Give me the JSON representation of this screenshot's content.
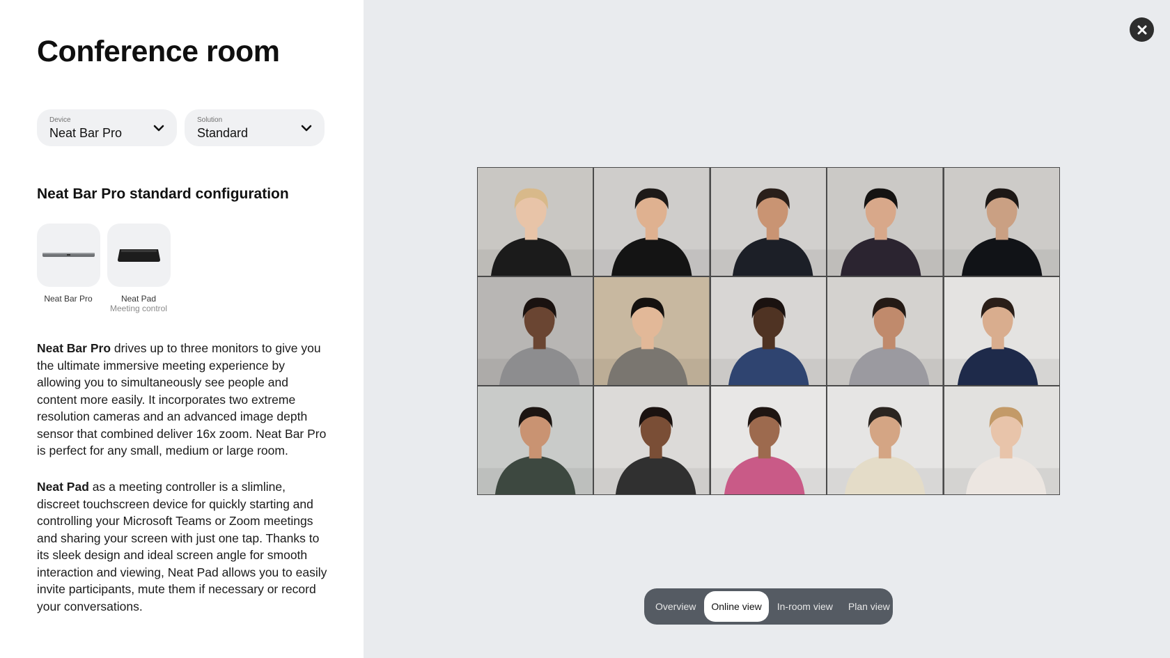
{
  "page": {
    "title": "Conference room"
  },
  "selectors": {
    "device": {
      "label": "Device",
      "value": "Neat Bar Pro"
    },
    "solution": {
      "label": "Solution",
      "value": "Standard"
    }
  },
  "configuration": {
    "heading": "Neat Bar Pro standard configuration",
    "items": [
      {
        "name": "Neat Bar Pro",
        "subtitle": ""
      },
      {
        "name": "Neat Pad",
        "subtitle": "Meeting control"
      }
    ]
  },
  "description": {
    "p1_bold": "Neat Bar Pro",
    "p1_text": " drives up to three monitors to give you the ultimate immersive meeting experience by allowing you to simultaneously see people and content more easily. It incorporates two extreme resolution cameras and an advanced image depth sensor that combined deliver 16x zoom. Neat Bar Pro is perfect for any small, medium or large room.",
    "p2_bold": "Neat Pad",
    "p2_text": " as a meeting controller is a slimline, discreet touchscreen device for quickly starting and controlling your Microsoft Teams or Zoom meetings and sharing your screen with just one tap. Thanks to its sleek design and ideal screen angle for smooth interaction and viewing, Neat Pad allows you to easily invite participants, mute them if necessary or record your conversations."
  },
  "views": {
    "tabs": [
      "Overview",
      "Online view",
      "In-room view",
      "Plan view"
    ],
    "active": "Online view"
  },
  "participants": [
    {
      "bg": "#c9c7c3",
      "skin": "#e8c4a8",
      "hair": "#d8b98a",
      "top": "#1b1b1b"
    },
    {
      "bg": "#cfcdcb",
      "skin": "#dfb190",
      "hair": "#1e1a18",
      "top": "#141414"
    },
    {
      "bg": "#d2d0ce",
      "skin": "#c99473",
      "hair": "#2a1f1a",
      "top": "#1c1f27"
    },
    {
      "bg": "#cbc9c6",
      "skin": "#d8a88a",
      "hair": "#151312",
      "top": "#2b2430"
    },
    {
      "bg": "#cdcbc8",
      "skin": "#caa083",
      "hair": "#1d1816",
      "top": "#111317"
    },
    {
      "bg": "#b8b6b4",
      "skin": "#6a4532",
      "hair": "#1a1210",
      "top": "#8d8d8f"
    },
    {
      "bg": "#c8b8a0",
      "skin": "#e2b898",
      "hair": "#15110f",
      "top": "#7a7670"
    },
    {
      "bg": "#d8d6d4",
      "skin": "#4f3323",
      "hair": "#1a1210",
      "top": "#2f4470"
    },
    {
      "bg": "#d4d2cf",
      "skin": "#c08a6c",
      "hair": "#241a15",
      "top": "#9b9aa0"
    },
    {
      "bg": "#e4e3e1",
      "skin": "#d9ad8e",
      "hair": "#2a1e18",
      "top": "#1e2a4a"
    },
    {
      "bg": "#c9cbc9",
      "skin": "#c99372",
      "hair": "#1c1512",
      "top": "#3d4840"
    },
    {
      "bg": "#dcdad8",
      "skin": "#7a4e36",
      "hair": "#1a1210",
      "top": "#303030"
    },
    {
      "bg": "#e8e7e6",
      "skin": "#9d6a4e",
      "hair": "#1e1512",
      "top": "#c95a87"
    },
    {
      "bg": "#e6e5e4",
      "skin": "#d4a584",
      "hair": "#2b2520",
      "top": "#e4dcc8"
    },
    {
      "bg": "#e2e1df",
      "skin": "#e8c4aa",
      "hair": "#c39a68",
      "top": "#ece6e1"
    }
  ],
  "colors": {
    "accent": "#555b63",
    "close": "#2d2d2d"
  },
  "icons": {
    "close": "close-icon",
    "chevron": "chevron-down-icon"
  }
}
